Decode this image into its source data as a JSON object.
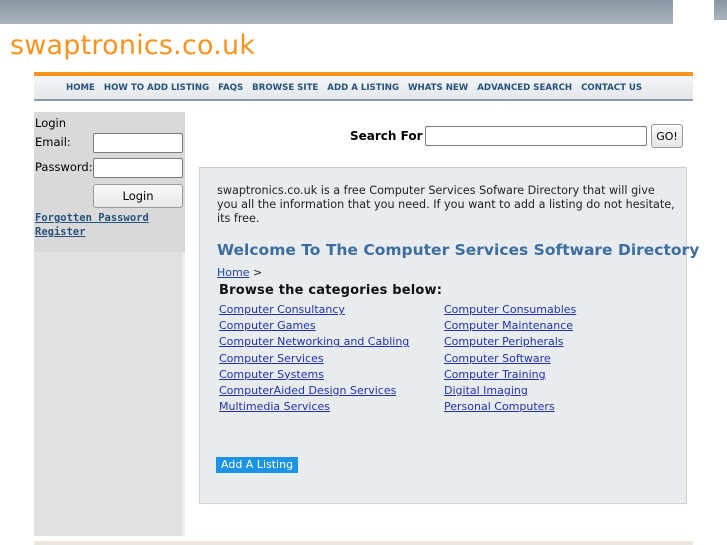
{
  "site": {
    "logo_text": "swaptronics.co.uk"
  },
  "nav": {
    "items": [
      {
        "label": "HOME"
      },
      {
        "label": "HOW TO ADD LISTING"
      },
      {
        "label": "FAQS"
      },
      {
        "label": "BROWSE SITE"
      },
      {
        "label": "ADD A LISTING"
      },
      {
        "label": "WHATS NEW"
      },
      {
        "label": "ADVANCED SEARCH"
      },
      {
        "label": "CONTACT US"
      }
    ]
  },
  "login": {
    "title": "Login",
    "email_label": "Email:",
    "email_value": "",
    "password_label": "Password:",
    "password_value": "",
    "button_label": "Login",
    "forgot_link": "Forgotten Password",
    "register_link": "Register"
  },
  "search": {
    "label": "Search For",
    "value": "",
    "button_label": "GO!"
  },
  "content": {
    "intro": "swaptronics.co.uk is a free Computer Services Sofware Directory that will give you all the information that you need. If you want to add a listing do not hesitate, its free.",
    "welcome_heading": "Welcome To The Computer Services Software Directory",
    "breadcrumb_home": "Home",
    "breadcrumb_separator": " >",
    "browse_heading": "Browse the categories below:",
    "categories_left": [
      "Computer Consultancy",
      "Computer Games",
      "Computer Networking and Cabling",
      "Computer Services",
      "Computer Systems",
      "ComputerAided Design Services",
      "Multimedia Services"
    ],
    "categories_right": [
      "Computer Consumables",
      "Computer Maintenance",
      "Computer Peripherals",
      "Computer Software",
      "Computer Training",
      "Digital Imaging",
      "Personal Computers"
    ],
    "add_listing_button": "Add A Listing"
  },
  "colors": {
    "brand_orange": "#f7931e",
    "nav_text": "#26527c",
    "heading_blue": "#3e6e9e",
    "link_blue": "#2233aa",
    "button_blue": "#1c94e6"
  }
}
